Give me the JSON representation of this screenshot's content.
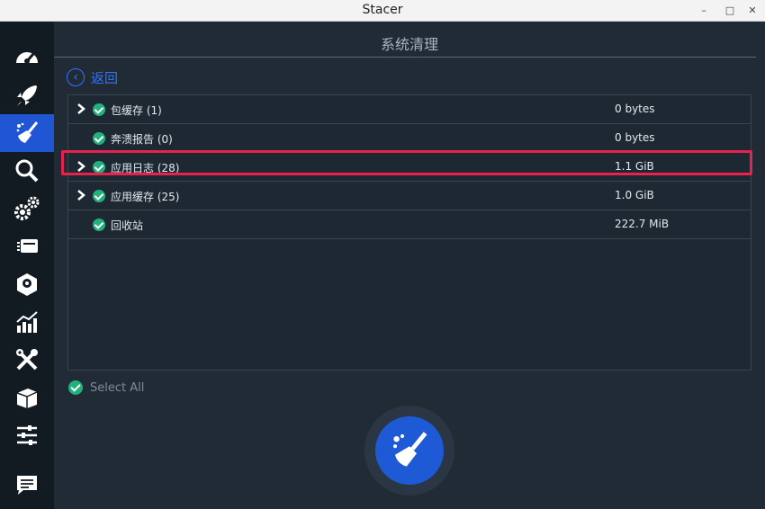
{
  "window": {
    "title": "Stacer",
    "minimize": "–",
    "maximize": "□",
    "close": "✕"
  },
  "sidebar": {
    "items": [
      {
        "name": "dashboard",
        "icon": "speedometer-icon",
        "active": false
      },
      {
        "name": "startup-apps",
        "icon": "rocket-icon",
        "active": false
      },
      {
        "name": "system-cleaner",
        "icon": "broom-icon",
        "active": true
      },
      {
        "name": "search",
        "icon": "search-icon",
        "active": false
      },
      {
        "name": "services",
        "icon": "gears-icon",
        "active": false
      },
      {
        "name": "processes",
        "icon": "cards-icon",
        "active": false
      },
      {
        "name": "uninstaller",
        "icon": "package-disk-icon",
        "active": false
      },
      {
        "name": "resources",
        "icon": "chart-icon",
        "active": false
      },
      {
        "name": "helpers",
        "icon": "tools-icon",
        "active": false
      },
      {
        "name": "apt-repository",
        "icon": "box-icon",
        "active": false
      },
      {
        "name": "settings",
        "icon": "sliders-icon",
        "active": false
      },
      {
        "name": "feedback",
        "icon": "message-icon",
        "active": false
      }
    ]
  },
  "page": {
    "title": "系统清理",
    "back_label": "返回"
  },
  "list": {
    "rows": [
      {
        "name": "包缓存 (1)",
        "size": "0 bytes",
        "expandable": true
      },
      {
        "name": "奔溃报告 (0)",
        "size": "0 bytes",
        "expandable": false
      },
      {
        "name": "应用日志 (28)",
        "size": "1.1 GiB",
        "expandable": true
      },
      {
        "name": "应用缓存 (25)",
        "size": "1.0 GiB",
        "expandable": true
      },
      {
        "name": "回收站",
        "size": "222.7 MiB",
        "expandable": false
      }
    ]
  },
  "select_all": {
    "label": "Select All",
    "checked": true
  },
  "colors": {
    "accent": "#2e74ff",
    "active_bg": "#2056d4",
    "check": "#22b07d",
    "highlight": "#e8224d"
  }
}
